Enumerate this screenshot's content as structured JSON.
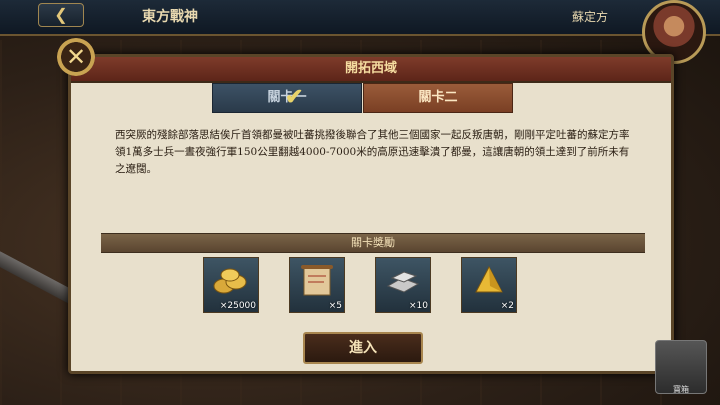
{
  "topbar": {
    "back_icon": "arrow-left-icon",
    "title": "東方戰神",
    "right_label": "蘇定方"
  },
  "dialog": {
    "title": "開拓西域",
    "close_icon": "close-icon",
    "tabs": [
      {
        "label": "關卡一",
        "completed": true
      },
      {
        "label": "關卡二",
        "completed": false
      }
    ],
    "description": "西突厥的殘餘部落思結俟斤首領都曼被吐蕃挑撥後聯合了其他三個國家一起反叛唐朝，剛剛平定吐蕃的蘇定方率領1萬多士兵一晝夜強行軍150公里翻越4000-7000米的高原迅速擊潰了都曼，這讓唐朝的領土達到了前所未有之遼闊。",
    "rewards_title": "關卡獎勵",
    "rewards": [
      {
        "icon": "gold-coins-icon",
        "count": "×25000"
      },
      {
        "icon": "scroll-map-icon",
        "count": "×5"
      },
      {
        "icon": "silver-ingot-icon",
        "count": "×10"
      },
      {
        "icon": "gold-pyramid-icon",
        "count": "×2"
      }
    ],
    "enter_label": "進入"
  },
  "chest": {
    "icon": "treasure-chest-icon",
    "label": "寶箱"
  },
  "colors": {
    "header": "#7e3b2a",
    "tab_active": "#9a5c3a",
    "tab_done": "#3d5266",
    "parchment": "#e8e0cc"
  }
}
